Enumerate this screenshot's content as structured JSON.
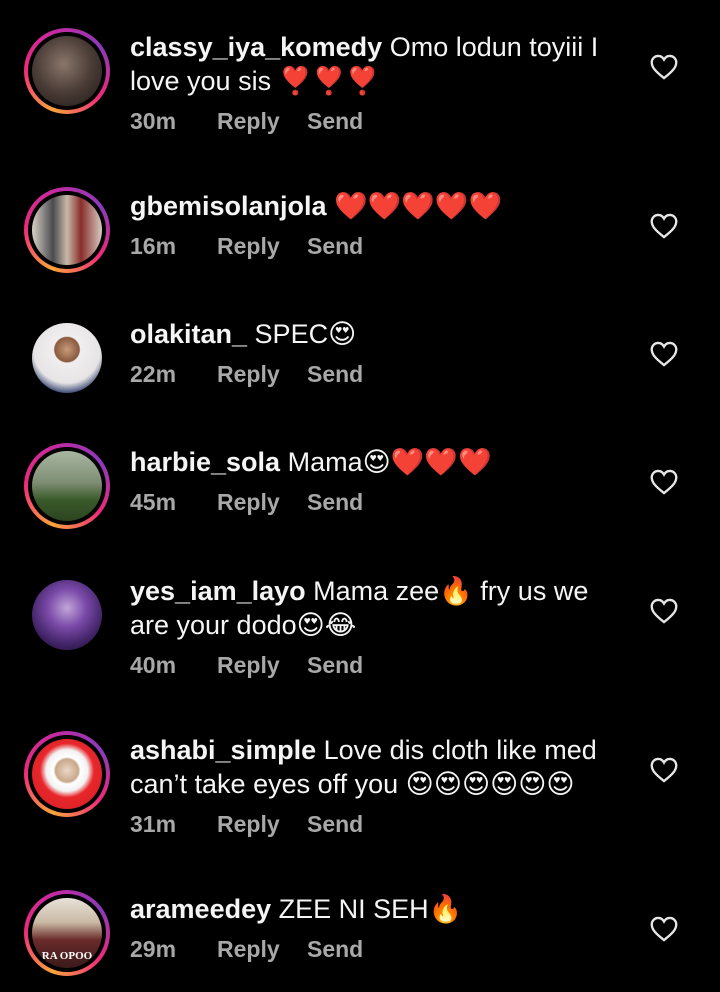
{
  "actions": {
    "reply_label": "Reply",
    "send_label": "Send"
  },
  "comments": [
    {
      "username": "classy_iya_komedy",
      "text": " Omo lodun toyiii I\nlove you sis ❣️❣️❣️",
      "time": "30m",
      "story_ring": true,
      "avatar_colors": [
        "#6b5a52",
        "#2a2220"
      ]
    },
    {
      "username": "gbemisolanjola",
      "text": " ❤️❤️❤️❤️❤️",
      "time": "16m",
      "story_ring": true,
      "avatar_colors": [
        "#c9b9a4",
        "#3b3a3d"
      ]
    },
    {
      "username": "olakitan_",
      "text": " SPEC😍",
      "time": "22m",
      "story_ring": false,
      "avatar_colors": [
        "#e8e6e6",
        "#3a2a2a"
      ]
    },
    {
      "username": "harbie_sola",
      "text": " Mama😍❤️❤️❤️",
      "time": "45m",
      "story_ring": true,
      "avatar_colors": [
        "#8e9c86",
        "#2b3a24"
      ]
    },
    {
      "username": "yes_iam_layo",
      "text": " Mama zee🔥 fry us we\nare your dodo😍😂",
      "time": "40m",
      "story_ring": false,
      "avatar_colors": [
        "#6a3b9a",
        "#2d1a45"
      ]
    },
    {
      "username": "ashabi_simple",
      "text": " Love dis cloth like med\ncan’t take eyes off you 😍😍😍😍😍😍",
      "time": "31m",
      "story_ring": true,
      "avatar_colors": [
        "#e8262b",
        "#ffffff"
      ]
    },
    {
      "username": "arameedey",
      "text": " ZEE NI SEH🔥",
      "time": "29m",
      "story_ring": true,
      "avatar_colors": [
        "#d9d2c8",
        "#7a2020"
      ],
      "avatar_caption": "RA OPOO"
    }
  ]
}
